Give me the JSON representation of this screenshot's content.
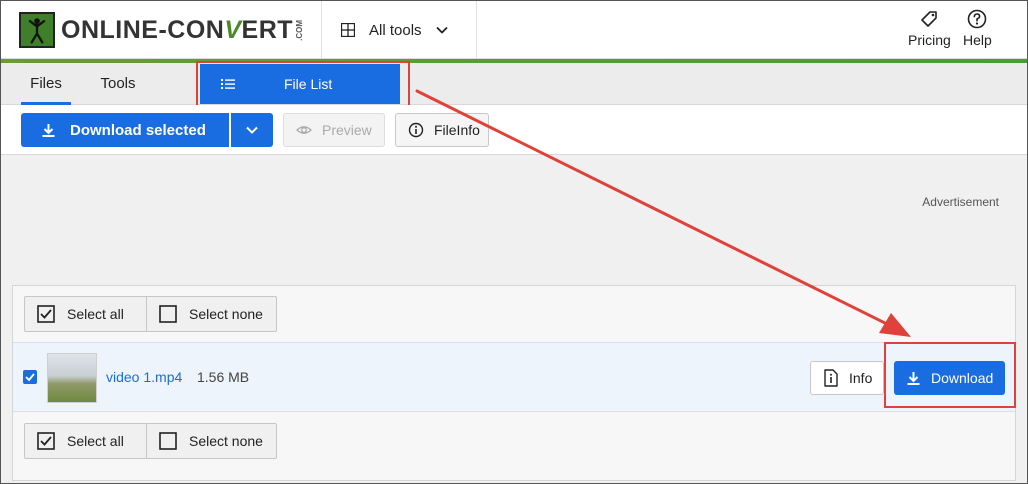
{
  "header": {
    "logo_text_1": "ONLINE-CON",
    "logo_text_v": "V",
    "logo_text_2": "ERT",
    "logo_com": ".COM",
    "all_tools_label": "All tools",
    "pricing_label": "Pricing",
    "help_label": "Help"
  },
  "tabs": {
    "files_label": "Files",
    "tools_label": "Tools",
    "file_list_label": "File List"
  },
  "toolbar": {
    "download_selected_label": "Download selected",
    "preview_label": "Preview",
    "fileinfo_label": "FileInfo"
  },
  "main": {
    "advertisement_label": "Advertisement",
    "select_all_label": "Select all",
    "select_none_label": "Select none",
    "file": {
      "name": "video 1.mp4",
      "size": "1.56 MB",
      "checked": true,
      "info_label": "Info",
      "download_label": "Download"
    }
  },
  "colors": {
    "primary_blue": "#1a6de0",
    "brand_green": "#4a8a2a",
    "annotation_red": "#e0413a"
  }
}
